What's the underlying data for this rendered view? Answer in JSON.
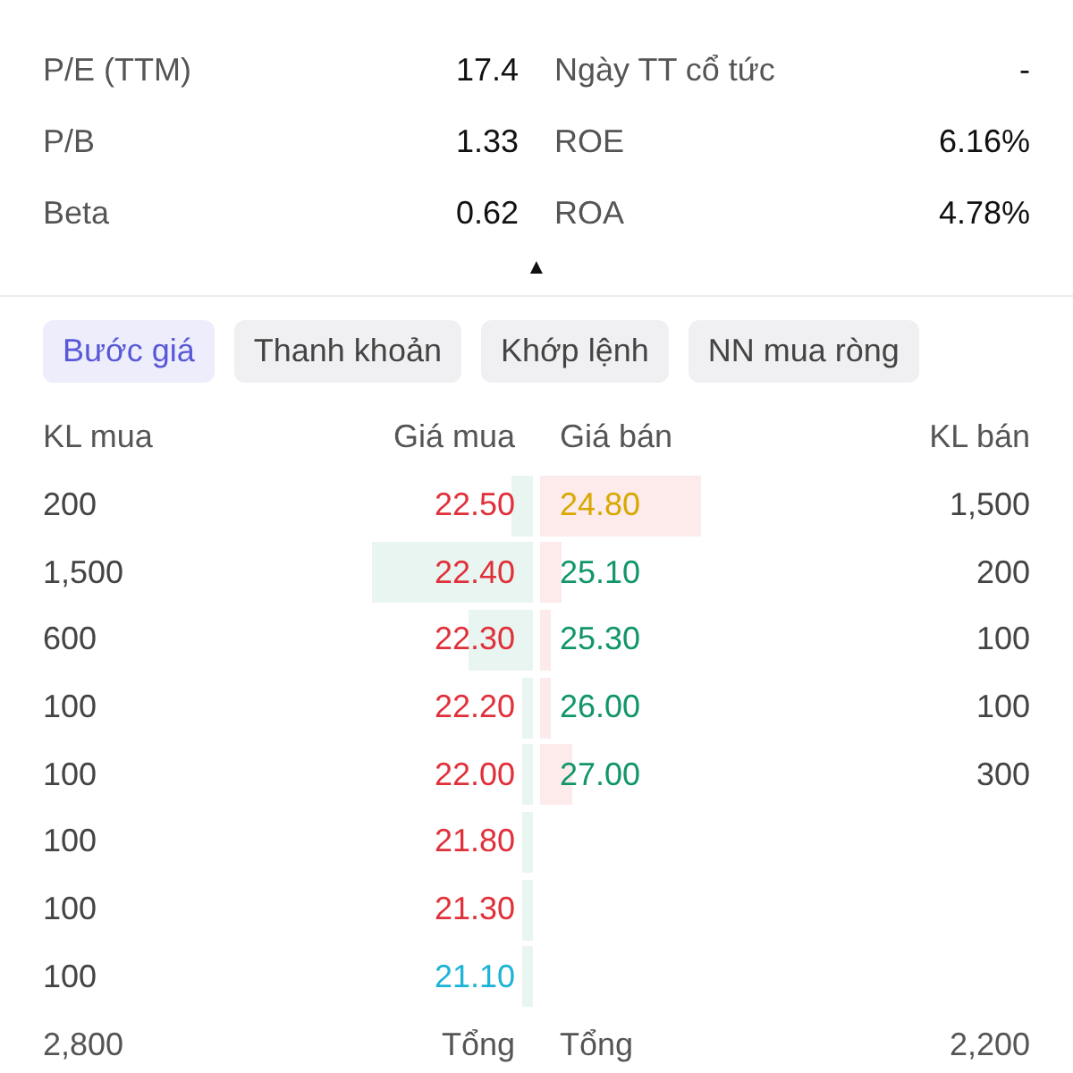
{
  "metrics": [
    {
      "label": "P/E (TTM)",
      "value": "17.4",
      "label_2": "Ngày TT cổ tức",
      "value_2": "-"
    },
    {
      "label": "P/B",
      "value": "1.33",
      "label_2": "ROE",
      "value_2": "6.16%"
    },
    {
      "label": "Beta",
      "value": "0.62",
      "label_2": "ROA",
      "value_2": "4.78%"
    }
  ],
  "collapse_toggle": "▲",
  "tabs": [
    {
      "label": "Bước giá",
      "selected": true
    },
    {
      "label": "Thanh khoản",
      "selected": false
    },
    {
      "label": "Khớp lệnh",
      "selected": false
    },
    {
      "label": "NN mua ròng",
      "selected": false
    }
  ],
  "order_book": {
    "columns": [
      "KL mua",
      "Giá mua",
      "Giá bán",
      "KL bán"
    ],
    "bids": [
      {
        "volume": "200",
        "price": "22.50",
        "color": "#e0303a"
      },
      {
        "volume": "1,500",
        "price": "22.40",
        "color": "#e0303a"
      },
      {
        "volume": "600",
        "price": "22.30",
        "color": "#e0303a"
      },
      {
        "volume": "100",
        "price": "22.20",
        "color": "#e0303a"
      },
      {
        "volume": "100",
        "price": "22.00",
        "color": "#e0303a"
      },
      {
        "volume": "100",
        "price": "21.80",
        "color": "#e0303a"
      },
      {
        "volume": "100",
        "price": "21.30",
        "color": "#e0303a"
      },
      {
        "volume": "100",
        "price": "21.10",
        "color": "#1cb3d8"
      }
    ],
    "asks": [
      {
        "volume": "1,500",
        "price": "24.80",
        "color": "#d9a800"
      },
      {
        "volume": "200",
        "price": "25.10",
        "color": "#11966a"
      },
      {
        "volume": "100",
        "price": "25.30",
        "color": "#11966a"
      },
      {
        "volume": "100",
        "price": "26.00",
        "color": "#11966a"
      },
      {
        "volume": "300",
        "price": "27.00",
        "color": "#11966a"
      }
    ],
    "bid_total": "2,800",
    "bid_total_label": "Tổng",
    "ask_total_label": "Tổng",
    "ask_total": "2,200"
  }
}
